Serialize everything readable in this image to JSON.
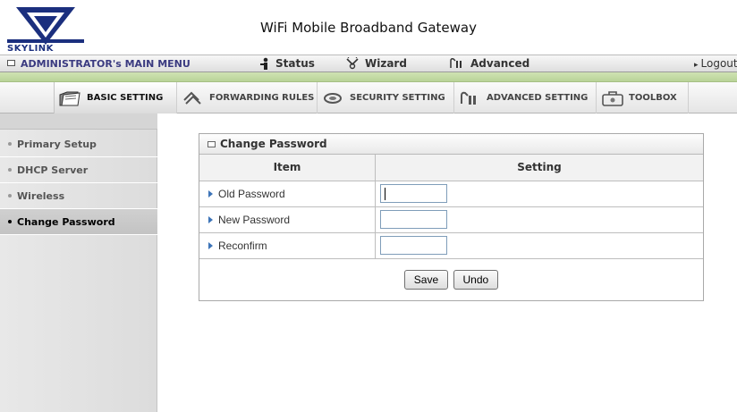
{
  "app": {
    "brand": "SKYLINK",
    "title": "WiFi Mobile Broadband Gateway"
  },
  "main_menu": {
    "admin": "ADMINISTRATOR's MAIN MENU",
    "status": "Status",
    "wizard": "Wizard",
    "advanced": "Advanced",
    "logout": "Logout"
  },
  "tabs": [
    {
      "label": "BASIC SETTING",
      "icon": "folder-icon",
      "active": true
    },
    {
      "label": "FORWARDING RULES",
      "icon": "routing-icon",
      "active": false
    },
    {
      "label": "SECURITY SETTING",
      "icon": "shield-icon",
      "active": false
    },
    {
      "label": "ADVANCED SETTING",
      "icon": "advanced-icon",
      "active": false
    },
    {
      "label": "TOOLBOX",
      "icon": "toolbox-icon",
      "active": false
    }
  ],
  "sidebar": {
    "items": [
      {
        "label": "Primary Setup",
        "active": false
      },
      {
        "label": "DHCP Server",
        "active": false
      },
      {
        "label": "Wireless",
        "active": false
      },
      {
        "label": "Change Password",
        "active": true
      }
    ]
  },
  "panel": {
    "title": "Change Password",
    "col_item": "Item",
    "col_setting": "Setting",
    "rows": [
      {
        "label": "Old Password",
        "value": ""
      },
      {
        "label": "New Password",
        "value": ""
      },
      {
        "label": "Reconfirm",
        "value": ""
      }
    ],
    "save": "Save",
    "undo": "Undo"
  },
  "colors": {
    "accent_green": "#cfe3b3",
    "brand_blue": "#1b2f7e",
    "arrow_blue": "#3d74b8"
  }
}
